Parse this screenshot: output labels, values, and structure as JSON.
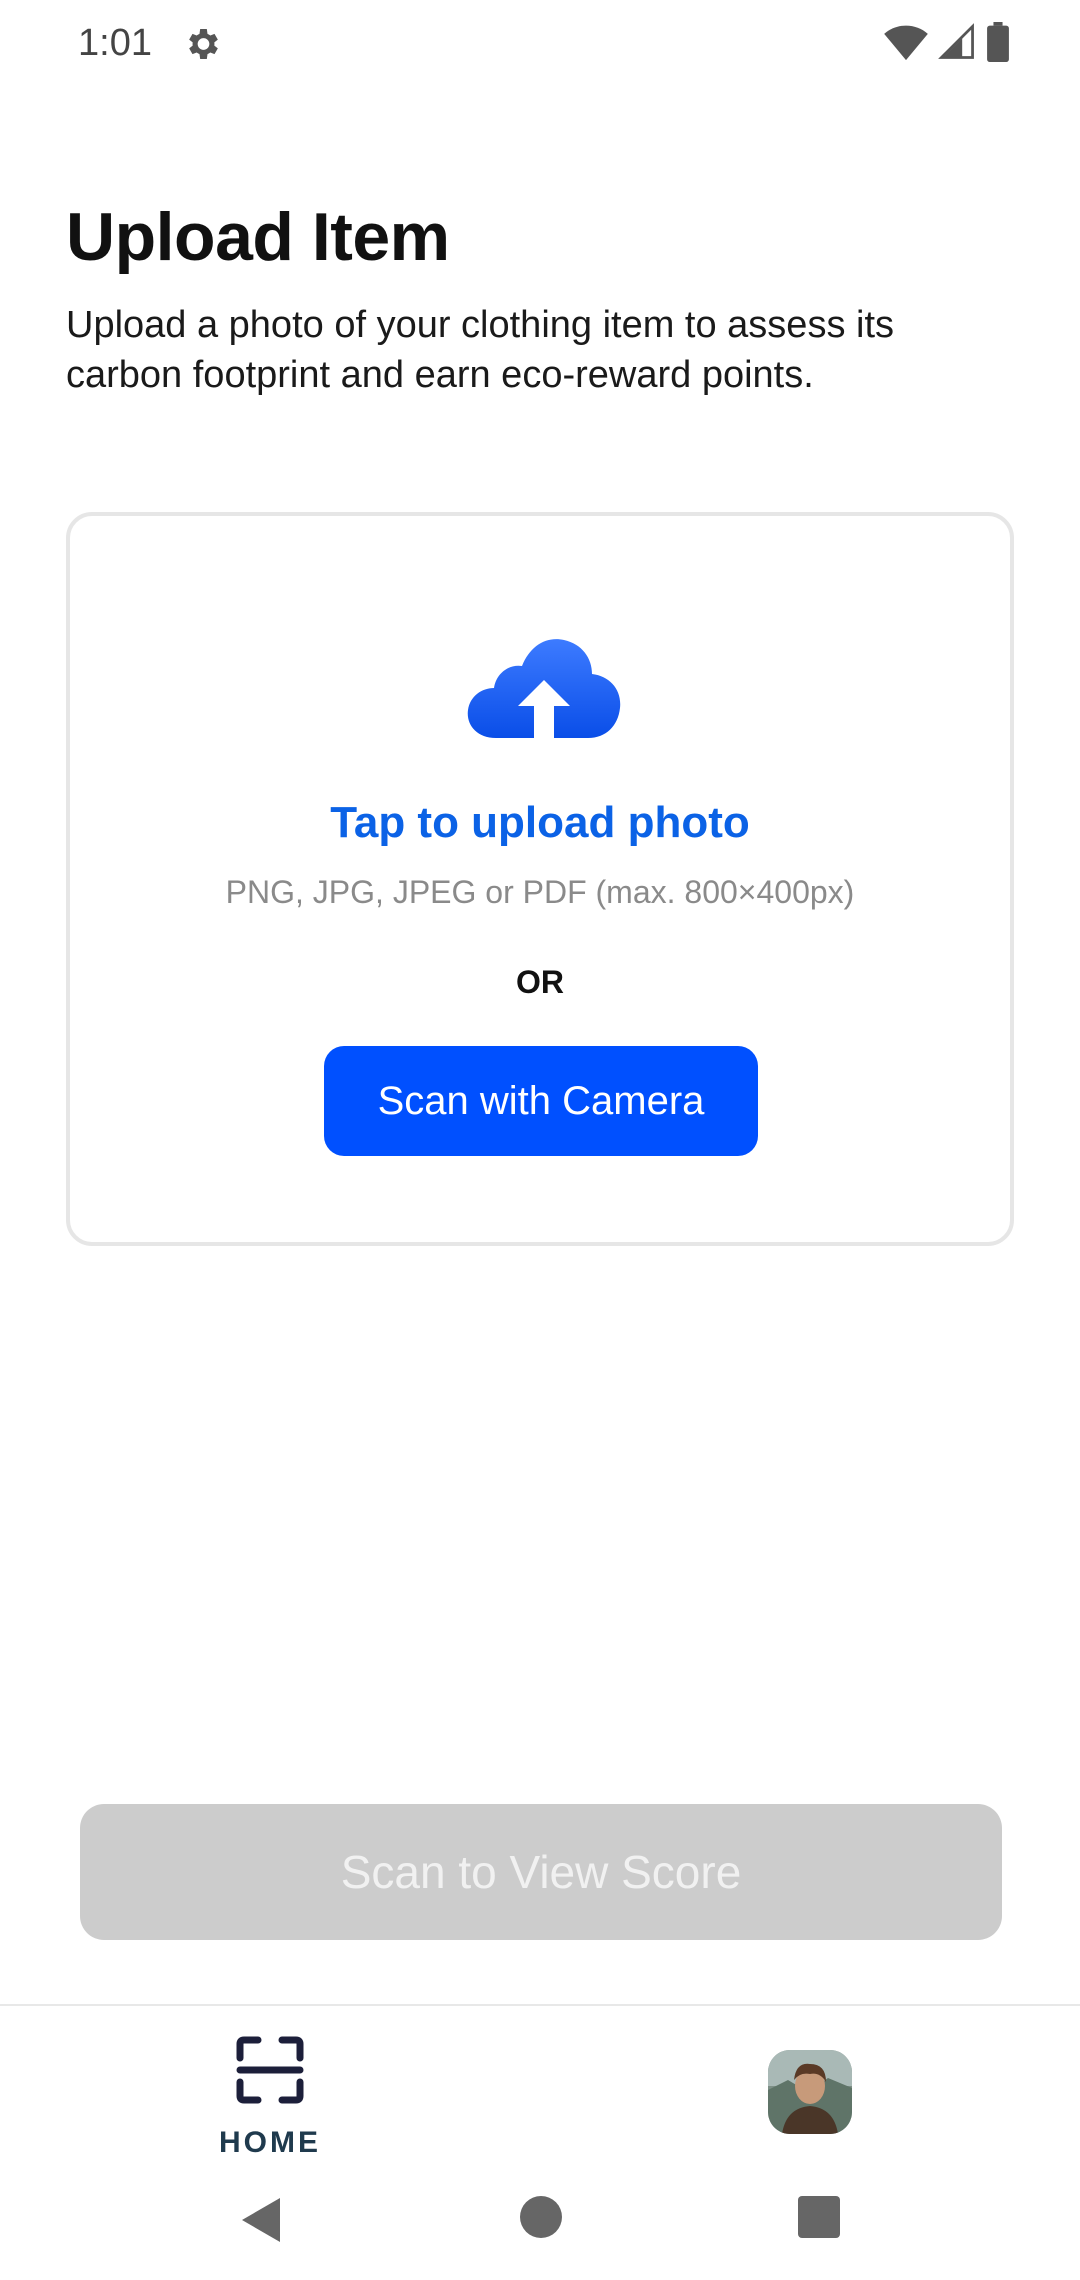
{
  "status_bar": {
    "time": "1:01",
    "icons": [
      "settings-gear-icon",
      "wifi-icon",
      "cell-signal-icon",
      "battery-icon"
    ]
  },
  "header": {
    "title": "Upload Item",
    "subtitle": "Upload a photo of your clothing item to assess its carbon footprint and earn eco-reward points."
  },
  "upload_card": {
    "icon": "cloud-upload-icon",
    "title": "Tap to upload photo",
    "hint": "PNG, JPG, JPEG or PDF (max. 800×400px)",
    "or_label": "OR",
    "camera_button": "Scan with Camera"
  },
  "actions": {
    "score_button": "Scan to View Score"
  },
  "bottom_nav": {
    "home_label": "HOME",
    "home_icon": "scan-frame-icon",
    "profile_icon": "avatar"
  },
  "system_nav": {
    "icons": [
      "back-icon",
      "home-circle-icon",
      "recents-icon"
    ]
  },
  "colors": {
    "accent_blue": "#0050ff",
    "link_blue": "#0b62e6",
    "disabled_gray": "#cccccc",
    "nav_dark": "#1f3a4d"
  }
}
